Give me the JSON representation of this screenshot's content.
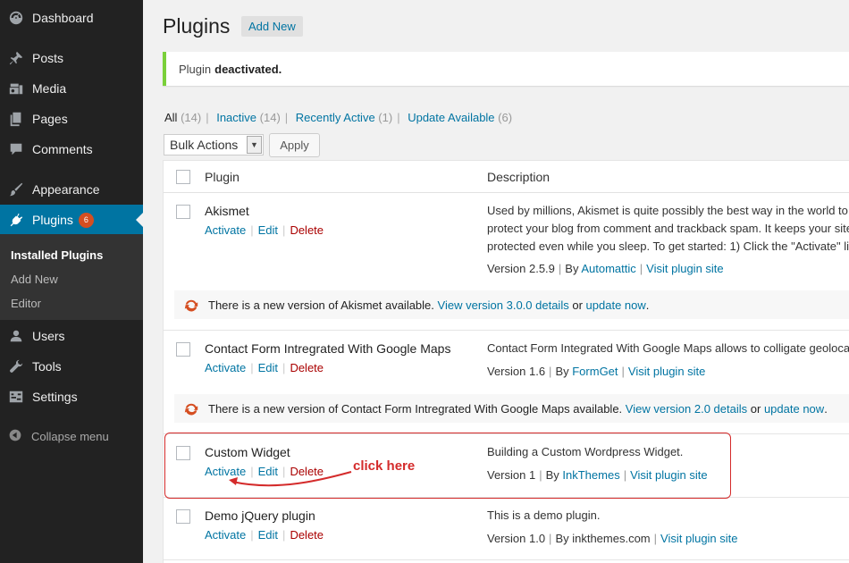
{
  "sidebar": {
    "items": [
      {
        "label": "Dashboard",
        "icon": "dashboard-icon"
      },
      {
        "label": "Posts",
        "icon": "pin-icon"
      },
      {
        "label": "Media",
        "icon": "media-icon"
      },
      {
        "label": "Pages",
        "icon": "pages-icon"
      },
      {
        "label": "Comments",
        "icon": "comment-icon"
      },
      {
        "label": "Appearance",
        "icon": "brush-icon"
      },
      {
        "label": "Plugins",
        "icon": "plug-icon",
        "badge": "6",
        "active": true
      },
      {
        "label": "Users",
        "icon": "user-icon"
      },
      {
        "label": "Tools",
        "icon": "wrench-icon"
      },
      {
        "label": "Settings",
        "icon": "settings-icon"
      }
    ],
    "submenu": [
      "Installed Plugins",
      "Add New",
      "Editor"
    ],
    "collapse_label": "Collapse menu"
  },
  "header": {
    "title": "Plugins",
    "add_new": "Add New"
  },
  "notice": {
    "prefix": "Plugin",
    "bold": "deactivated."
  },
  "filters": [
    {
      "label": "All",
      "count": "(14)"
    },
    {
      "label": "Inactive",
      "count": "(14)"
    },
    {
      "label": "Recently Active",
      "count": "(1)"
    },
    {
      "label": "Update Available",
      "count": "(6)"
    }
  ],
  "bulk_actions": {
    "selected": "Bulk Actions",
    "apply": "Apply"
  },
  "table": {
    "col_plugin": "Plugin",
    "col_description": "Description",
    "action_labels": {
      "activate": "Activate",
      "edit": "Edit",
      "delete": "Delete"
    },
    "plugins": [
      {
        "name": "Akismet",
        "description": "Used by millions, Akismet is quite possibly the best way in the world to protect your blog from comment and trackback spam. It keeps your site protected even while you sleep. To get started: 1) Click the \"Activate\" link to the left of this description, 2) Sign up for an Akismet API key, and 3) Go to your Akismet configuration page, and save your API key.",
        "version": "Version 2.5.9",
        "by": "By",
        "author": "Automattic",
        "visit": "Visit plugin site",
        "update": {
          "text": "There is a new version of Akismet available.",
          "details_link": "View version 3.0.0 details",
          "or": "or",
          "update_link": "update now",
          "end": "."
        }
      },
      {
        "name": "Contact Form Intregrated With Google Maps",
        "description": "Contact Form Integrated With Google Maps allows to colligate geolocation with a contact form.",
        "version": "Version 1.6",
        "by": "By",
        "author": "FormGet",
        "visit": "Visit plugin site",
        "update": {
          "text": "There is a new version of Contact Form Intregrated With Google Maps available.",
          "details_link": "View version 2.0 details",
          "or": "or",
          "update_link": "update now",
          "end": "."
        }
      },
      {
        "name": "Custom Widget",
        "description": "Building a Custom Wordpress Widget.",
        "version": "Version 1",
        "by": "By",
        "author": "InkThemes",
        "visit": "Visit plugin site"
      },
      {
        "name": "Demo jQuery plugin",
        "description": "This is a demo plugin.",
        "version": "Version 1.0",
        "by": "By inkthemes.com",
        "visit": "Visit plugin site"
      }
    ]
  },
  "annotation": {
    "text": "click here",
    "color": "#d42b2b"
  },
  "colors": {
    "sidebar_bg": "#222222",
    "active_bg": "#0074a2",
    "link": "#0074a2",
    "delete": "#aa0000",
    "notice_border": "#7ad03a",
    "badge": "#d54e21",
    "update_icon": "#d54e21"
  }
}
